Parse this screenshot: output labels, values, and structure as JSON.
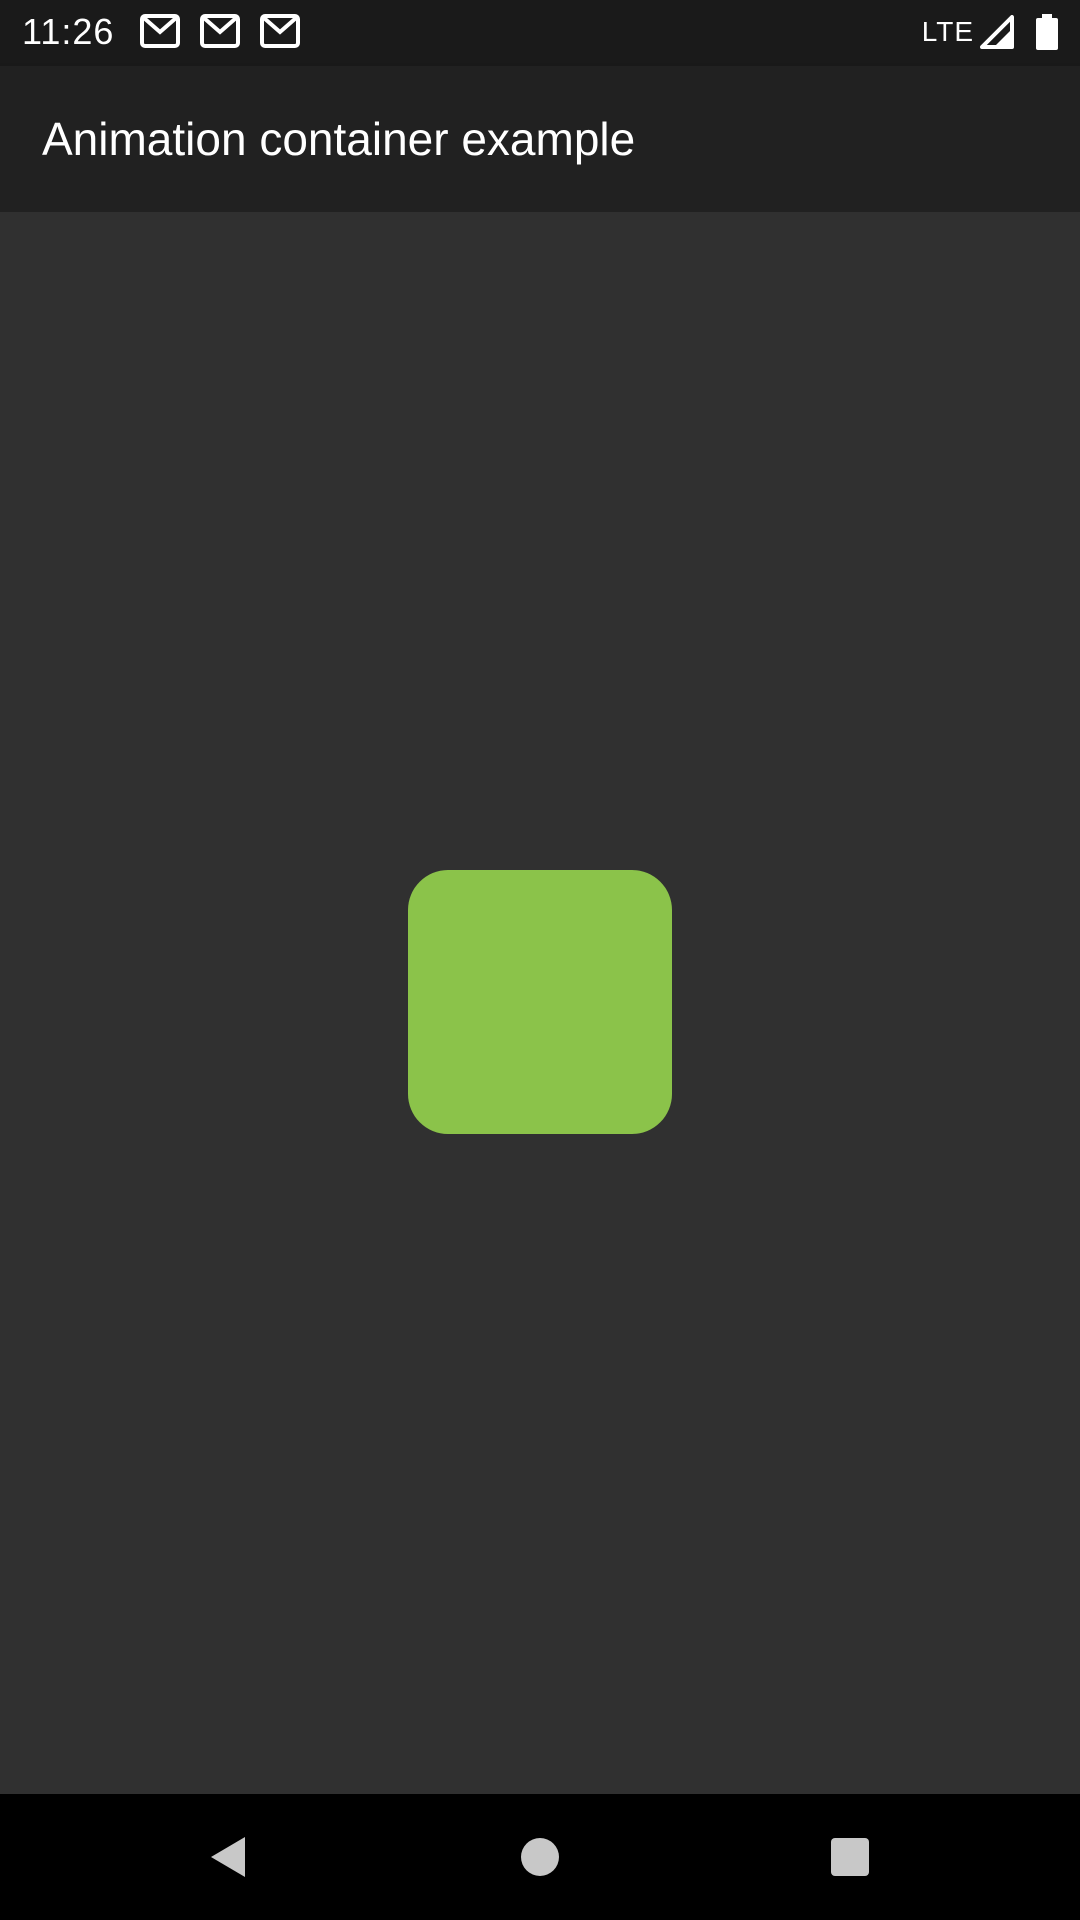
{
  "status_bar": {
    "time": "11:26",
    "notification_icons": [
      "gmail-icon",
      "gmail-icon",
      "gmail-icon"
    ],
    "network": "LTE",
    "signal_icon": "signal-icon",
    "battery_icon": "battery-icon"
  },
  "app_bar": {
    "title": "Animation container example"
  },
  "content": {
    "animated_box": {
      "color": "#8bc34a",
      "shape": "rounded-square"
    }
  },
  "nav_bar": {
    "back_icon": "back-icon",
    "home_icon": "home-icon",
    "recents_icon": "recents-icon"
  },
  "colors": {
    "status_bar": "#1a1a1a",
    "app_bar": "#212121",
    "background": "#303030",
    "nav_bar": "#000000",
    "accent": "#8bc34a"
  }
}
